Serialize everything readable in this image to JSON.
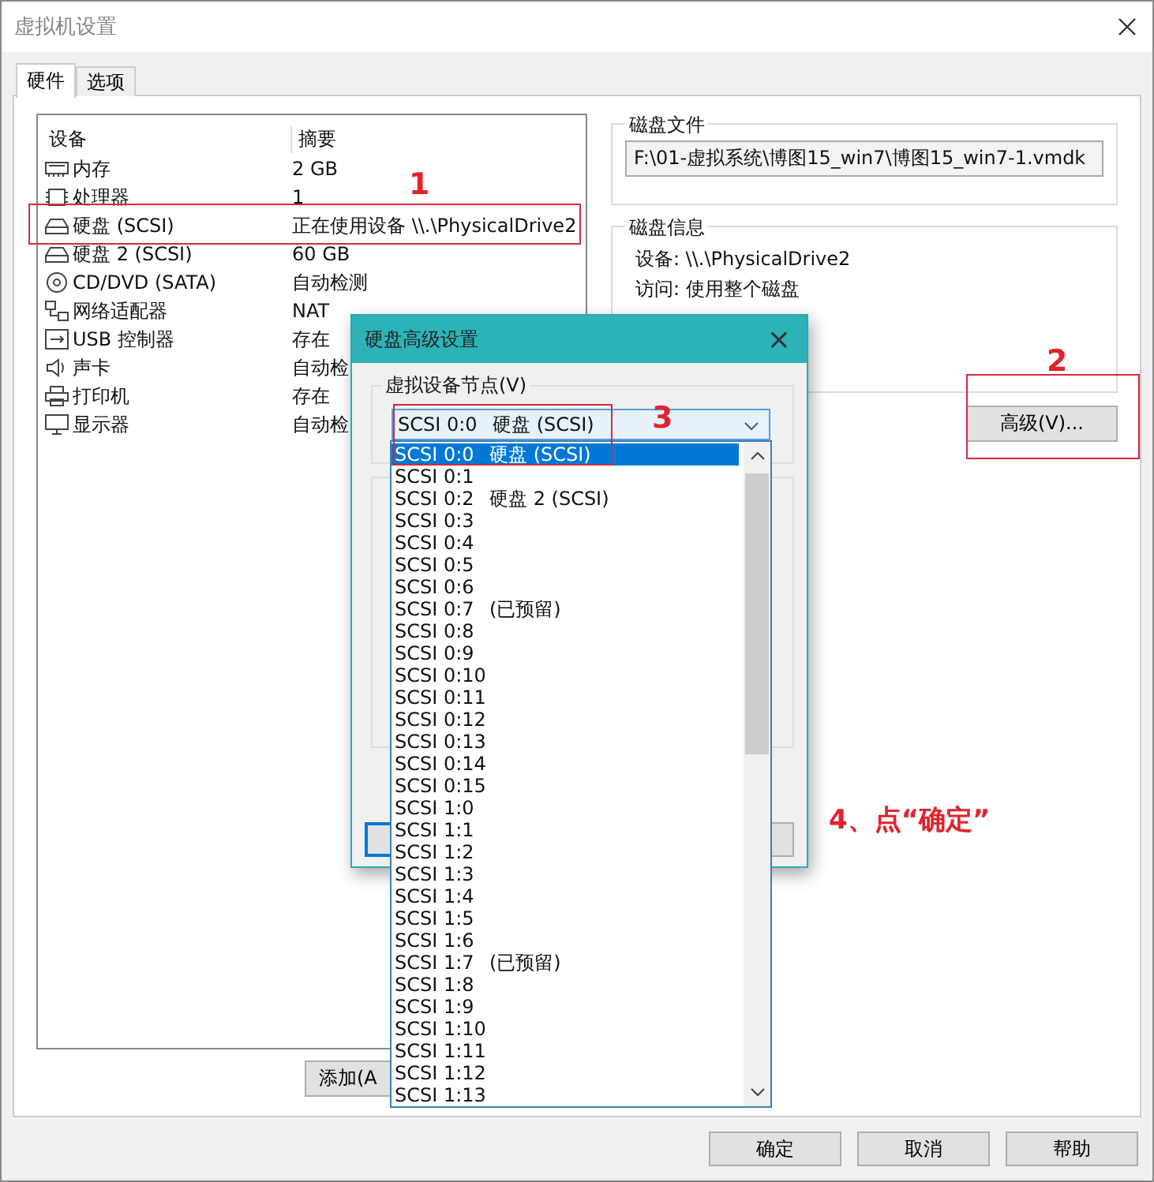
{
  "window": {
    "title": "虚拟机设置"
  },
  "tabs": [
    {
      "label": "硬件",
      "selected": true
    },
    {
      "label": "选项",
      "selected": false
    }
  ],
  "devices": {
    "columns": [
      "设备",
      "摘要"
    ],
    "rows": [
      {
        "name": "内存",
        "summary": "2 GB"
      },
      {
        "name": "处理器",
        "summary": "1"
      },
      {
        "name": "硬盘 (SCSI)",
        "summary": "正在使用设备 \\\\.\\PhysicalDrive2"
      },
      {
        "name": "硬盘 2 (SCSI)",
        "summary": "60 GB"
      },
      {
        "name": "CD/DVD (SATA)",
        "summary": "自动检测"
      },
      {
        "name": "网络适配器",
        "summary": "NAT"
      },
      {
        "name": "USB 控制器",
        "summary": "存在"
      },
      {
        "name": "声卡",
        "summary": "自动检"
      },
      {
        "name": "打印机",
        "summary": "存在"
      },
      {
        "name": "显示器",
        "summary": "自动检"
      }
    ]
  },
  "add_button": "添加(A",
  "disk_file": {
    "label": "磁盘文件",
    "value": "F:\\01-虚拟系统\\博图15_win7\\博图15_win7-1.vmdk"
  },
  "disk_info": {
    "label": "磁盘信息",
    "lines": [
      "设备: \\\\.\\PhysicalDrive2",
      "访问: 使用整个磁盘"
    ]
  },
  "advanced_button": "高级(V)...",
  "footer_buttons": [
    "确定",
    "取消",
    "帮助"
  ],
  "dialog": {
    "title": "硬盘高级设置",
    "close": "×",
    "node_group": "虚拟设备节点(V)",
    "combo_value": [
      "SCSI 0:0",
      "硬盘 (SCSI)"
    ],
    "options": [
      {
        "node": "SCSI 0:0",
        "note": "硬盘 (SCSI)",
        "selected": true
      },
      {
        "node": "SCSI 0:1",
        "selected": false
      },
      {
        "node": "SCSI 0:2",
        "note": "硬盘 2 (SCSI)",
        "selected": false
      },
      {
        "node": "SCSI 0:3",
        "selected": false
      },
      {
        "node": "SCSI 0:4",
        "selected": false
      },
      {
        "node": "SCSI 0:5",
        "selected": false
      },
      {
        "node": "SCSI 0:6",
        "selected": false
      },
      {
        "node": "SCSI 0:7",
        "note": "(已预留)",
        "selected": false
      },
      {
        "node": "SCSI 0:8",
        "selected": false
      },
      {
        "node": "SCSI 0:9",
        "selected": false
      },
      {
        "node": "SCSI 0:10",
        "selected": false
      },
      {
        "node": "SCSI 0:11",
        "selected": false
      },
      {
        "node": "SCSI 0:12",
        "selected": false
      },
      {
        "node": "SCSI 0:13",
        "selected": false
      },
      {
        "node": "SCSI 0:14",
        "selected": false
      },
      {
        "node": "SCSI 0:15",
        "selected": false
      },
      {
        "node": "SCSI 1:0",
        "selected": false
      },
      {
        "node": "SCSI 1:1",
        "selected": false
      },
      {
        "node": "SCSI 1:2",
        "selected": false
      },
      {
        "node": "SCSI 1:3",
        "selected": false
      },
      {
        "node": "SCSI 1:4",
        "selected": false
      },
      {
        "node": "SCSI 1:5",
        "selected": false
      },
      {
        "node": "SCSI 1:6",
        "selected": false
      },
      {
        "node": "SCSI 1:7",
        "note": "(已预留)",
        "selected": false
      },
      {
        "node": "SCSI 1:8",
        "selected": false
      },
      {
        "node": "SCSI 1:9",
        "selected": false
      },
      {
        "node": "SCSI 1:10",
        "selected": false
      },
      {
        "node": "SCSI 1:11",
        "selected": false
      },
      {
        "node": "SCSI 1:12",
        "selected": false
      },
      {
        "node": "SCSI 1:13",
        "selected": false
      }
    ]
  },
  "annotations": [
    "1",
    "2",
    "3",
    "4、点“确定”"
  ]
}
